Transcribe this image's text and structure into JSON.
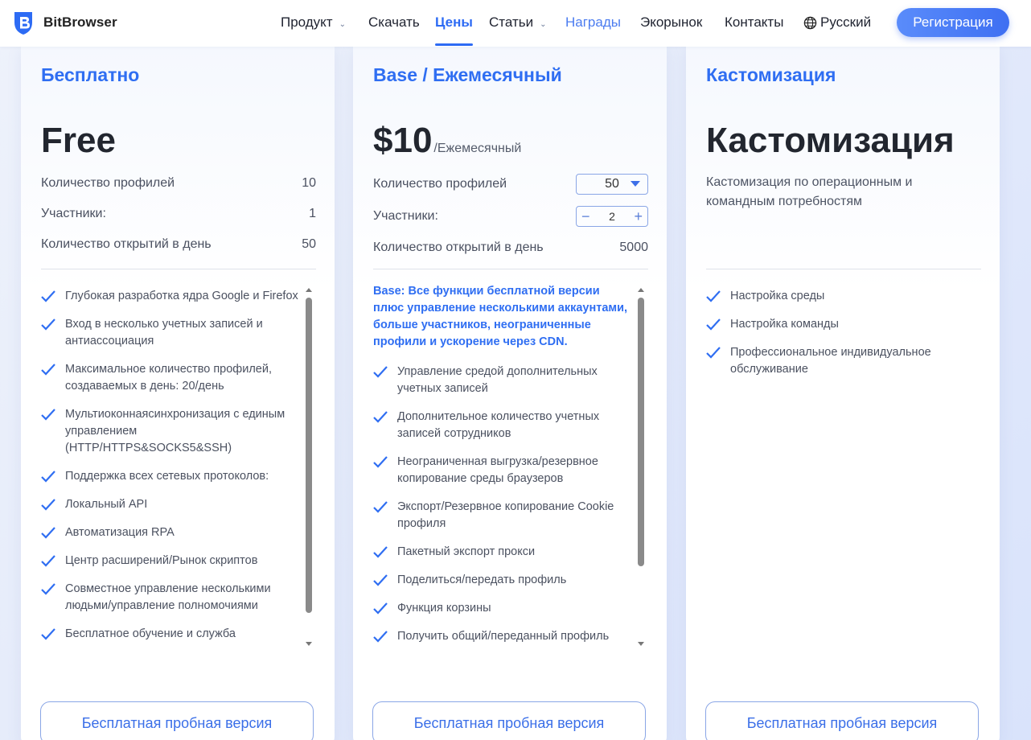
{
  "header": {
    "logo_text": "BitBrowser",
    "nav": {
      "product": "Продукт",
      "download": "Скачать",
      "prices": "Цены",
      "articles": "Статьи",
      "awards": "Награды",
      "ecomarket": "Экорынок",
      "contacts": "Контакты",
      "language": "Русский"
    },
    "register": "Регистрация"
  },
  "plans": {
    "free": {
      "name": "Бесплатно",
      "price": "Free",
      "specs": [
        {
          "label": "Количество профилей",
          "value": "10"
        },
        {
          "label": "Участники:",
          "value": "1"
        },
        {
          "label": "Количество открытий в день",
          "value": "50"
        }
      ],
      "features": [
        "Глубокая разработка ядра Google и Firefox",
        "Вход в несколько учетных записей и антиассоциация",
        "Максимальное количество профилей, создаваемых в день: 20/день",
        "Мультиоконнаясинхронизация с единым управлением (HTTP/HTTPS&SOCKS5&SSH)",
        "Поддержка всех сетевых протоколов:",
        "Локальный API",
        "Автоматизация RPA",
        "Центр расширений/Рынок скриптов",
        "Совместное управление несколькими людьми/управление полномочиями",
        "Бесплатное обучение и служба"
      ],
      "cta": "Бесплатная пробная версия"
    },
    "base": {
      "name": "Base / Ежемесячный",
      "price": "$10",
      "price_unit": "/Ежемесячный",
      "specs": [
        {
          "label": "Количество профилей",
          "value": "50"
        },
        {
          "label": "Участники:",
          "value": "2"
        },
        {
          "label": "Количество открытий в день",
          "value": "5000"
        }
      ],
      "intro": "Base: Все функции бесплатной версии плюс управление несколькими аккаунтами, больше участников, неограниченные профили и ускорение через CDN.",
      "features": [
        "Управление средой дополнительных учетных записей",
        "Дополнительное количество учетных записей сотрудников",
        "Неограниченная выгрузка/резервное копирование среды браузеров",
        "Экспорт/Резервное копирование Cookie профиля",
        "Пакетный экспорт прокси",
        "Поделиться/передать профиль",
        "Функция корзины",
        "Получить общий/переданный профиль"
      ],
      "cta": "Бесплатная пробная версия"
    },
    "custom": {
      "name": "Кастомизация",
      "title": "Кастомизация",
      "description": "Кастомизация по операционным и командным потребностям",
      "features": [
        "Настройка среды",
        "Настройка команды",
        "Профессиональное индивидуальное обслуживание"
      ],
      "cta": "Бесплатная пробная версия"
    }
  },
  "colors": {
    "accent": "#2f6ef2",
    "text": "#4b5160"
  },
  "icons": {
    "logo": "bitbrowser-shield-icon",
    "check": "check-icon",
    "globe": "globe-icon",
    "chevron": "chevron-down-icon"
  }
}
